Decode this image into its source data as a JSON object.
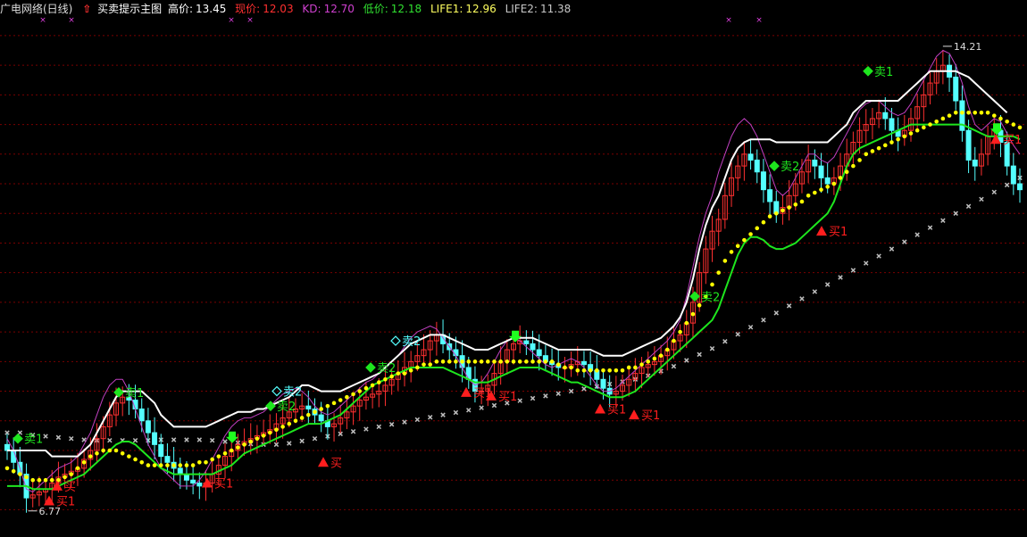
{
  "header": {
    "title": "广电网络(日线)",
    "indicator_name": "买卖提示主图",
    "high": {
      "label": "高价:",
      "value": "13.45",
      "color": "#ffffff"
    },
    "price": {
      "label": "现价:",
      "value": "12.03",
      "color": "#ff3030"
    },
    "kd": {
      "label": "KD:",
      "value": "12.70",
      "color": "#d040d0"
    },
    "low": {
      "label": "低价:",
      "value": "12.18",
      "color": "#30e030"
    },
    "life1": {
      "label": "LIFE1:",
      "value": "12.96",
      "color": "#ffff60"
    },
    "life2": {
      "label": "LIFE2:",
      "value": "11.38",
      "color": "#c8c8c8"
    }
  },
  "chart_data": {
    "type": "candlestick",
    "ylim": [
      6.2,
      14.9
    ],
    "grid_levels": [
      6.6,
      7.1,
      7.6,
      8.1,
      8.6,
      9.1,
      9.6,
      10.1,
      10.6,
      11.1,
      11.6,
      12.1,
      12.6,
      13.1,
      13.6,
      14.1,
      14.6
    ],
    "annotations": {
      "max_price": "14.21",
      "min_price": "6.77"
    },
    "colors": {
      "up": "#ff3030",
      "down": "#54ffff",
      "pressure": "#ffffff",
      "support": "#1ee61e",
      "kd": "#c040c0",
      "life1": "#ffff00",
      "life2": "#bebebe",
      "sell": "#1ee61e",
      "sell_hollow": "#54ffff",
      "buy": "#ff1e1e"
    },
    "closes": [
      7.6,
      7.4,
      7.2,
      6.8,
      6.85,
      6.9,
      6.95,
      7.05,
      7.15,
      7.2,
      7.25,
      7.3,
      7.45,
      7.6,
      7.8,
      8.0,
      8.2,
      8.4,
      8.5,
      8.45,
      8.3,
      8.1,
      7.9,
      7.7,
      7.5,
      7.4,
      7.3,
      7.2,
      7.1,
      7.05,
      7.0,
      7.05,
      7.2,
      7.35,
      7.5,
      7.6,
      7.7,
      7.75,
      7.8,
      7.85,
      7.9,
      7.95,
      8.05,
      8.15,
      8.25,
      8.3,
      8.35,
      8.3,
      8.2,
      8.1,
      8.0,
      8.05,
      8.15,
      8.25,
      8.35,
      8.45,
      8.5,
      8.55,
      8.6,
      8.7,
      8.8,
      8.9,
      9.0,
      9.1,
      9.2,
      9.3,
      9.45,
      9.55,
      9.4,
      9.3,
      9.2,
      9.0,
      8.8,
      8.6,
      8.6,
      8.7,
      8.9,
      9.1,
      9.3,
      9.4,
      9.45,
      9.4,
      9.3,
      9.2,
      9.1,
      9.05,
      9.0,
      9.0,
      9.05,
      9.1,
      9.05,
      8.95,
      8.8,
      8.65,
      8.55,
      8.6,
      8.7,
      8.8,
      8.9,
      9.0,
      9.05,
      9.1,
      9.2,
      9.3,
      9.45,
      9.55,
      9.75,
      10.1,
      10.6,
      11.0,
      11.3,
      11.5,
      11.9,
      12.2,
      12.4,
      12.6,
      12.5,
      12.3,
      12.0,
      11.8,
      11.6,
      11.7,
      11.9,
      12.1,
      12.3,
      12.5,
      12.4,
      12.2,
      12.1,
      12.2,
      12.4,
      12.6,
      12.8,
      13.0,
      13.1,
      13.2,
      13.3,
      13.2,
      13.0,
      12.9,
      13.0,
      13.2,
      13.4,
      13.6,
      13.8,
      14.0,
      14.1,
      13.9,
      13.5,
      13.0,
      12.5,
      12.4,
      12.6,
      12.9,
      13.0,
      12.8,
      12.4,
      12.1,
      12.0
    ],
    "pressure_line": [
      7.6,
      7.6,
      7.6,
      7.6,
      7.6,
      7.6,
      7.6,
      7.5,
      7.5,
      7.5,
      7.5,
      7.5,
      7.6,
      7.7,
      7.9,
      8.1,
      8.3,
      8.5,
      8.6,
      8.6,
      8.6,
      8.6,
      8.5,
      8.4,
      8.2,
      8.1,
      8.0,
      8.0,
      8.0,
      8.0,
      8.0,
      8.0,
      8.05,
      8.1,
      8.15,
      8.2,
      8.25,
      8.25,
      8.25,
      8.3,
      8.3,
      8.35,
      8.4,
      8.45,
      8.5,
      8.6,
      8.7,
      8.7,
      8.65,
      8.6,
      8.6,
      8.6,
      8.6,
      8.65,
      8.7,
      8.75,
      8.8,
      8.85,
      8.9,
      9.0,
      9.1,
      9.2,
      9.3,
      9.4,
      9.45,
      9.5,
      9.55,
      9.55,
      9.55,
      9.5,
      9.45,
      9.4,
      9.35,
      9.3,
      9.3,
      9.3,
      9.35,
      9.4,
      9.45,
      9.5,
      9.5,
      9.5,
      9.5,
      9.45,
      9.4,
      9.35,
      9.3,
      9.3,
      9.3,
      9.3,
      9.3,
      9.3,
      9.25,
      9.2,
      9.2,
      9.2,
      9.2,
      9.25,
      9.3,
      9.35,
      9.4,
      9.45,
      9.5,
      9.6,
      9.7,
      9.85,
      10.1,
      10.5,
      11.0,
      11.4,
      11.7,
      11.9,
      12.2,
      12.5,
      12.7,
      12.8,
      12.85,
      12.85,
      12.85,
      12.85,
      12.8,
      12.8,
      12.8,
      12.8,
      12.8,
      12.8,
      12.8,
      12.8,
      12.8,
      12.9,
      13.0,
      13.1,
      13.3,
      13.4,
      13.5,
      13.5,
      13.5,
      13.5,
      13.5,
      13.5,
      13.6,
      13.7,
      13.8,
      13.9,
      14.0,
      14.0,
      14.0,
      14.0,
      14.0,
      13.95,
      13.9,
      13.8,
      13.7,
      13.6,
      13.5,
      13.4,
      13.3
    ],
    "support_line": [
      7.0,
      7.0,
      7.0,
      7.0,
      6.95,
      6.95,
      6.95,
      6.95,
      7.0,
      7.05,
      7.1,
      7.15,
      7.2,
      7.3,
      7.4,
      7.5,
      7.6,
      7.7,
      7.75,
      7.75,
      7.7,
      7.6,
      7.5,
      7.4,
      7.3,
      7.25,
      7.2,
      7.2,
      7.2,
      7.2,
      7.2,
      7.2,
      7.2,
      7.25,
      7.3,
      7.35,
      7.45,
      7.55,
      7.6,
      7.65,
      7.7,
      7.75,
      7.8,
      7.85,
      7.9,
      7.95,
      8.0,
      8.05,
      8.05,
      8.05,
      8.1,
      8.15,
      8.2,
      8.3,
      8.4,
      8.5,
      8.6,
      8.7,
      8.75,
      8.8,
      8.85,
      8.9,
      8.95,
      9.0,
      9.0,
      9.0,
      9.0,
      9.0,
      9.0,
      8.95,
      8.9,
      8.85,
      8.8,
      8.75,
      8.75,
      8.75,
      8.8,
      8.85,
      8.9,
      8.95,
      9.0,
      9.0,
      9.0,
      9.0,
      8.95,
      8.9,
      8.85,
      8.8,
      8.75,
      8.75,
      8.7,
      8.65,
      8.6,
      8.55,
      8.5,
      8.5,
      8.5,
      8.55,
      8.6,
      8.7,
      8.8,
      8.9,
      9.0,
      9.1,
      9.2,
      9.3,
      9.4,
      9.5,
      9.6,
      9.7,
      9.8,
      10.0,
      10.3,
      10.6,
      10.9,
      11.1,
      11.2,
      11.2,
      11.15,
      11.05,
      11.0,
      11.0,
      11.05,
      11.1,
      11.2,
      11.3,
      11.4,
      11.5,
      11.6,
      11.8,
      12.1,
      12.4,
      12.6,
      12.7,
      12.75,
      12.8,
      12.85,
      12.9,
      12.95,
      13.0,
      13.05,
      13.1,
      13.1,
      13.1,
      13.1,
      13.1,
      13.1,
      13.1,
      13.1,
      13.1,
      13.05,
      13.0,
      12.95,
      12.9,
      12.9,
      12.9,
      12.9,
      12.9,
      12.85
    ],
    "kd_line": [
      7.8,
      7.6,
      7.3,
      6.95,
      6.9,
      7.0,
      7.1,
      7.2,
      7.3,
      7.35,
      7.4,
      7.5,
      7.7,
      7.9,
      8.2,
      8.5,
      8.7,
      8.8,
      8.8,
      8.6,
      8.3,
      8.0,
      7.7,
      7.5,
      7.3,
      7.2,
      7.1,
      7.0,
      7.0,
      7.0,
      7.1,
      7.25,
      7.45,
      7.65,
      7.85,
      8.0,
      8.1,
      8.15,
      8.15,
      8.2,
      8.25,
      8.35,
      8.45,
      8.55,
      8.6,
      8.65,
      8.6,
      8.5,
      8.35,
      8.25,
      8.2,
      8.25,
      8.35,
      8.45,
      8.55,
      8.65,
      8.75,
      8.8,
      8.9,
      9.0,
      9.1,
      9.2,
      9.35,
      9.5,
      9.6,
      9.65,
      9.7,
      9.65,
      9.5,
      9.35,
      9.2,
      9.0,
      8.8,
      8.7,
      8.75,
      8.9,
      9.1,
      9.3,
      9.45,
      9.5,
      9.45,
      9.35,
      9.25,
      9.15,
      9.05,
      9.0,
      9.05,
      9.1,
      9.15,
      9.1,
      9.0,
      8.85,
      8.7,
      8.6,
      8.6,
      8.65,
      8.75,
      8.85,
      8.95,
      9.05,
      9.15,
      9.25,
      9.35,
      9.45,
      9.6,
      9.8,
      10.2,
      10.7,
      11.2,
      11.6,
      11.9,
      12.3,
      12.6,
      12.9,
      13.1,
      13.2,
      13.1,
      12.9,
      12.6,
      12.3,
      12.0,
      11.9,
      12.0,
      12.2,
      12.4,
      12.6,
      12.6,
      12.5,
      12.45,
      12.55,
      12.75,
      12.95,
      13.15,
      13.35,
      13.45,
      13.5,
      13.5,
      13.4,
      13.3,
      13.25,
      13.3,
      13.45,
      13.65,
      13.85,
      14.05,
      14.25,
      14.35,
      14.3,
      14.1,
      13.8,
      13.4,
      13.1,
      13.0,
      13.1,
      13.2,
      13.15,
      12.95,
      12.75,
      12.6
    ],
    "life1_line": [
      7.3,
      7.25,
      7.2,
      7.15,
      7.1,
      7.1,
      7.1,
      7.1,
      7.1,
      7.15,
      7.2,
      7.3,
      7.4,
      7.5,
      7.55,
      7.6,
      7.6,
      7.6,
      7.55,
      7.5,
      7.45,
      7.4,
      7.35,
      7.35,
      7.35,
      7.35,
      7.35,
      7.35,
      7.35,
      7.35,
      7.4,
      7.4,
      7.45,
      7.5,
      7.55,
      7.6,
      7.65,
      7.7,
      7.75,
      7.8,
      7.85,
      7.9,
      7.95,
      8.0,
      8.05,
      8.1,
      8.15,
      8.2,
      8.25,
      8.3,
      8.35,
      8.4,
      8.45,
      8.5,
      8.55,
      8.6,
      8.65,
      8.7,
      8.75,
      8.8,
      8.85,
      8.9,
      8.9,
      8.95,
      9.0,
      9.05,
      9.05,
      9.1,
      9.1,
      9.1,
      9.1,
      9.1,
      9.1,
      9.1,
      9.1,
      9.1,
      9.1,
      9.1,
      9.1,
      9.1,
      9.1,
      9.1,
      9.1,
      9.1,
      9.1,
      9.1,
      9.05,
      9.0,
      9.0,
      8.95,
      8.95,
      8.95,
      8.95,
      8.95,
      8.95,
      8.95,
      8.95,
      9.0,
      9.0,
      9.05,
      9.1,
      9.15,
      9.2,
      9.3,
      9.45,
      9.6,
      9.75,
      9.9,
      10.05,
      10.2,
      10.4,
      10.6,
      10.8,
      10.95,
      11.05,
      11.15,
      11.25,
      11.35,
      11.45,
      11.55,
      11.6,
      11.65,
      11.7,
      11.75,
      11.8,
      11.9,
      11.95,
      12.0,
      12.05,
      12.1,
      12.2,
      12.3,
      12.4,
      12.5,
      12.6,
      12.65,
      12.7,
      12.75,
      12.8,
      12.85,
      12.9,
      12.95,
      13.0,
      13.05,
      13.1,
      13.15,
      13.2,
      13.25,
      13.3,
      13.3,
      13.3,
      13.3,
      13.3,
      13.3,
      13.25,
      13.2,
      13.15,
      13.1,
      13.05
    ],
    "life2_line": [
      7.9,
      7.9,
      7.9,
      7.88,
      7.86,
      7.85,
      7.84,
      7.83,
      7.82,
      7.81,
      7.8,
      7.79,
      7.78,
      7.77,
      7.77,
      7.77,
      7.77,
      7.77,
      7.77,
      7.77,
      7.77,
      7.77,
      7.77,
      7.77,
      7.78,
      7.78,
      7.78,
      7.78,
      7.78,
      7.78,
      7.78,
      7.78,
      7.77,
      7.76,
      7.75,
      7.74,
      7.73,
      7.72,
      7.71,
      7.7,
      7.7,
      7.7,
      7.7,
      7.7,
      7.72,
      7.74,
      7.76,
      7.78,
      7.8,
      7.82,
      7.84,
      7.86,
      7.88,
      7.9,
      7.92,
      7.94,
      7.96,
      7.98,
      8.0,
      8.02,
      8.04,
      8.06,
      8.08,
      8.1,
      8.12,
      8.14,
      8.16,
      8.18,
      8.2,
      8.22,
      8.24,
      8.26,
      8.28,
      8.3,
      8.32,
      8.34,
      8.36,
      8.38,
      8.4,
      8.42,
      8.44,
      8.46,
      8.48,
      8.5,
      8.52,
      8.54,
      8.56,
      8.58,
      8.6,
      8.62,
      8.64,
      8.66,
      8.68,
      8.7,
      8.72,
      8.74,
      8.76,
      8.78,
      8.8,
      8.83,
      8.86,
      8.9,
      8.94,
      8.98,
      9.02,
      9.07,
      9.12,
      9.17,
      9.22,
      9.27,
      9.32,
      9.38,
      9.44,
      9.5,
      9.56,
      9.62,
      9.68,
      9.74,
      9.8,
      9.86,
      9.92,
      9.98,
      10.04,
      10.1,
      10.16,
      10.22,
      10.28,
      10.34,
      10.4,
      10.46,
      10.52,
      10.58,
      10.64,
      10.7,
      10.76,
      10.82,
      10.88,
      10.94,
      11.0,
      11.06,
      11.12,
      11.18,
      11.24,
      11.3,
      11.36,
      11.42,
      11.48,
      11.54,
      11.6,
      11.66,
      11.72,
      11.78,
      11.84,
      11.9,
      11.96,
      12.02,
      12.08,
      12.14,
      12.2,
      12.26,
      12.32
    ],
    "signals": [
      {
        "text": "卖1",
        "type": "sell",
        "x": 20,
        "price": 7.8
      },
      {
        "text": "买1",
        "type": "buy",
        "x": 55,
        "price": 6.75
      },
      {
        "text": "买",
        "type": "buy",
        "x": 64,
        "price": 7.0
      },
      {
        "text": "卖1",
        "type": "sell",
        "x": 133,
        "price": 8.58
      },
      {
        "text": "买1",
        "type": "buy",
        "x": 232,
        "price": 7.05
      },
      {
        "text": "卖2",
        "type": "sell",
        "x": 303,
        "price": 8.35
      },
      {
        "text": "卖2",
        "type": "sell_hollow",
        "x": 310,
        "price": 8.6
      },
      {
        "text": "买",
        "type": "buy",
        "x": 362,
        "price": 7.4
      },
      {
        "text": "卖2",
        "type": "sell_hollow",
        "x": 443,
        "price": 9.45
      },
      {
        "text": "卖2",
        "type": "sell",
        "x": 415,
        "price": 9.0
      },
      {
        "text": "买1",
        "type": "buy",
        "x": 522,
        "price": 8.58
      },
      {
        "text": "买1",
        "type": "buy",
        "x": 550,
        "price": 8.52
      },
      {
        "text": "买1",
        "type": "buy",
        "x": 672,
        "price": 8.3
      },
      {
        "text": "买1",
        "type": "buy",
        "x": 710,
        "price": 8.2
      },
      {
        "text": "卖2",
        "type": "sell",
        "x": 778,
        "price": 10.2
      },
      {
        "text": "卖2",
        "type": "sell",
        "x": 867,
        "price": 12.4
      },
      {
        "text": "买1",
        "type": "buy",
        "x": 920,
        "price": 11.3
      },
      {
        "text": "卖1",
        "type": "sell",
        "x": 972,
        "price": 14.0
      },
      {
        "text": "买1",
        "type": "buy",
        "x": 1115,
        "price": 12.85
      }
    ],
    "down_arrows": [
      {
        "x": 260,
        "price": 7.8
      },
      {
        "x": 577,
        "price": 9.5
      },
      {
        "x": 1116,
        "price": 13.0
      }
    ],
    "magenta_markers": [
      48,
      80,
      259,
      280,
      816,
      850
    ]
  }
}
